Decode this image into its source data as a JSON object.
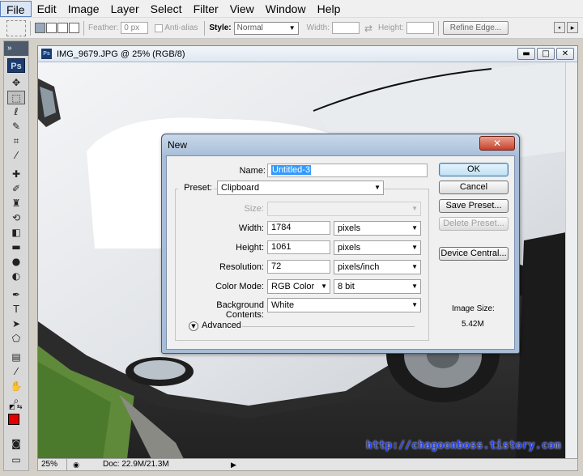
{
  "menubar": {
    "items": [
      "File",
      "Edit",
      "Image",
      "Layer",
      "Select",
      "Filter",
      "View",
      "Window",
      "Help"
    ]
  },
  "options": {
    "feather_label": "Feather:",
    "feather_value": "0 px",
    "antialias_label": "Anti-alias",
    "style_label": "Style:",
    "style_value": "Normal",
    "width_label": "Width:",
    "height_label": "Height:",
    "refine_edge": "Refine Edge..."
  },
  "toolbox": {
    "header": "»",
    "logo": "Ps"
  },
  "document": {
    "title": "IMG_9679.JPG @ 25% (RGB/8)",
    "ps_icon": "Ps",
    "minimize": "▬",
    "maximize": "□",
    "close": "✕"
  },
  "status": {
    "zoom": "25%",
    "doc": "Doc: 22.9M/21.3M",
    "arrow": "▶"
  },
  "watermark": "http://chagoonboss.tistory.com",
  "dialog": {
    "title": "New",
    "close": "✕",
    "name_label": "Name:",
    "name_value": "Untitled-3",
    "preset_label": "Preset:",
    "preset_value": "Clipboard",
    "size_label": "Size:",
    "size_value": "",
    "width_label": "Width:",
    "width_value": "1784",
    "width_unit": "pixels",
    "height_label": "Height:",
    "height_value": "1061",
    "height_unit": "pixels",
    "resolution_label": "Resolution:",
    "resolution_value": "72",
    "resolution_unit": "pixels/inch",
    "colormode_label": "Color Mode:",
    "colormode_value": "RGB Color",
    "bitdepth_value": "8 bit",
    "bg_label": "Background Contents:",
    "bg_value": "White",
    "advanced_label": "Advanced",
    "ok": "OK",
    "cancel": "Cancel",
    "save_preset": "Save Preset...",
    "delete_preset": "Delete Preset...",
    "device_central": "Device Central...",
    "image_size_label": "Image Size:",
    "image_size_value": "5.42M"
  }
}
